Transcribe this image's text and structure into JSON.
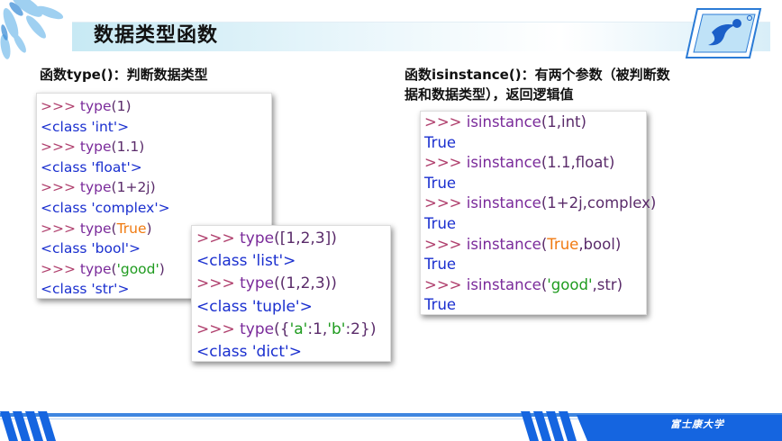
{
  "slide": {
    "title": "数据类型函数",
    "left_heading": "函数type()：判断数据类型",
    "right_heading_line1": "函数isinstance()：有两个参数（被判断数",
    "right_heading_line2": "据和数据类型），返回逻辑值",
    "footer": "富士康大学"
  },
  "colors": {
    "prompt": "#b0406e",
    "function": "#7a2a9a",
    "string": "#1f9b1f",
    "keyword": "#f07a10",
    "output": "#1a2fcf",
    "footer_blue": "#1565e0"
  },
  "panel_type_basic": {
    "lines": [
      {
        "prompt": ">>> ",
        "fn": "type",
        "open": "(",
        "parts": [
          {
            "t": "1",
            "c": "num"
          }
        ],
        "close": ")"
      },
      {
        "out": "<class 'int'>"
      },
      {
        "prompt": ">>> ",
        "fn": "type",
        "open": "(",
        "parts": [
          {
            "t": "1.1",
            "c": "num"
          }
        ],
        "close": ")"
      },
      {
        "out": "<class 'float'>"
      },
      {
        "prompt": ">>> ",
        "fn": "type",
        "open": "(",
        "parts": [
          {
            "t": "1+2j",
            "c": "num"
          }
        ],
        "close": ")"
      },
      {
        "out": "<class 'complex'>"
      },
      {
        "prompt": ">>> ",
        "fn": "type",
        "open": "(",
        "parts": [
          {
            "t": "True",
            "c": "kw"
          }
        ],
        "close": ")"
      },
      {
        "out": "<class 'bool'>"
      },
      {
        "prompt": ">>> ",
        "fn": "type",
        "open": "(",
        "parts": [
          {
            "t": "'good'",
            "c": "str"
          }
        ],
        "close": ")"
      },
      {
        "out": "<class 'str'>"
      }
    ]
  },
  "panel_type_containers": {
    "lines": [
      {
        "prompt": ">>> ",
        "fn": "type",
        "open": "(",
        "parts": [
          {
            "t": "[1,2,3]",
            "c": "num"
          }
        ],
        "close": ")"
      },
      {
        "out": "<class 'list'>"
      },
      {
        "prompt": ">>> ",
        "fn": "type",
        "open": "(",
        "parts": [
          {
            "t": "(1,2,3)",
            "c": "num"
          }
        ],
        "close": ")"
      },
      {
        "out": "<class 'tuple'>"
      },
      {
        "prompt": ">>> ",
        "fn": "type",
        "open": "(",
        "parts": [
          {
            "t": "{",
            "c": "num"
          },
          {
            "t": "'a'",
            "c": "str"
          },
          {
            "t": ":1,",
            "c": "num"
          },
          {
            "t": "'b'",
            "c": "str"
          },
          {
            "t": ":2}",
            "c": "num"
          }
        ],
        "close": ")"
      },
      {
        "out": "<class 'dict'>"
      }
    ]
  },
  "panel_isinstance": {
    "lines": [
      {
        "prompt": ">>> ",
        "fn": "isinstance",
        "open": "(",
        "parts": [
          {
            "t": "1,int",
            "c": "num"
          }
        ],
        "close": ")"
      },
      {
        "out": "True"
      },
      {
        "prompt": ">>> ",
        "fn": "isinstance",
        "open": "(",
        "parts": [
          {
            "t": "1.1,float",
            "c": "num"
          }
        ],
        "close": ")"
      },
      {
        "out": "True"
      },
      {
        "prompt": ">>> ",
        "fn": "isinstance",
        "open": "(",
        "parts": [
          {
            "t": "1+2j,complex",
            "c": "num"
          }
        ],
        "close": ")"
      },
      {
        "out": "True"
      },
      {
        "prompt": ">>> ",
        "fn": "isinstance",
        "open": "(",
        "parts": [
          {
            "t": "True",
            "c": "kw"
          },
          {
            "t": ",bool",
            "c": "num"
          }
        ],
        "close": ")"
      },
      {
        "out": "True"
      },
      {
        "prompt": ">>> ",
        "fn": "isinstance",
        "open": "(",
        "parts": [
          {
            "t": "'good'",
            "c": "str"
          },
          {
            "t": ",str",
            "c": "num"
          }
        ],
        "close": ")"
      },
      {
        "out": "True"
      }
    ]
  }
}
